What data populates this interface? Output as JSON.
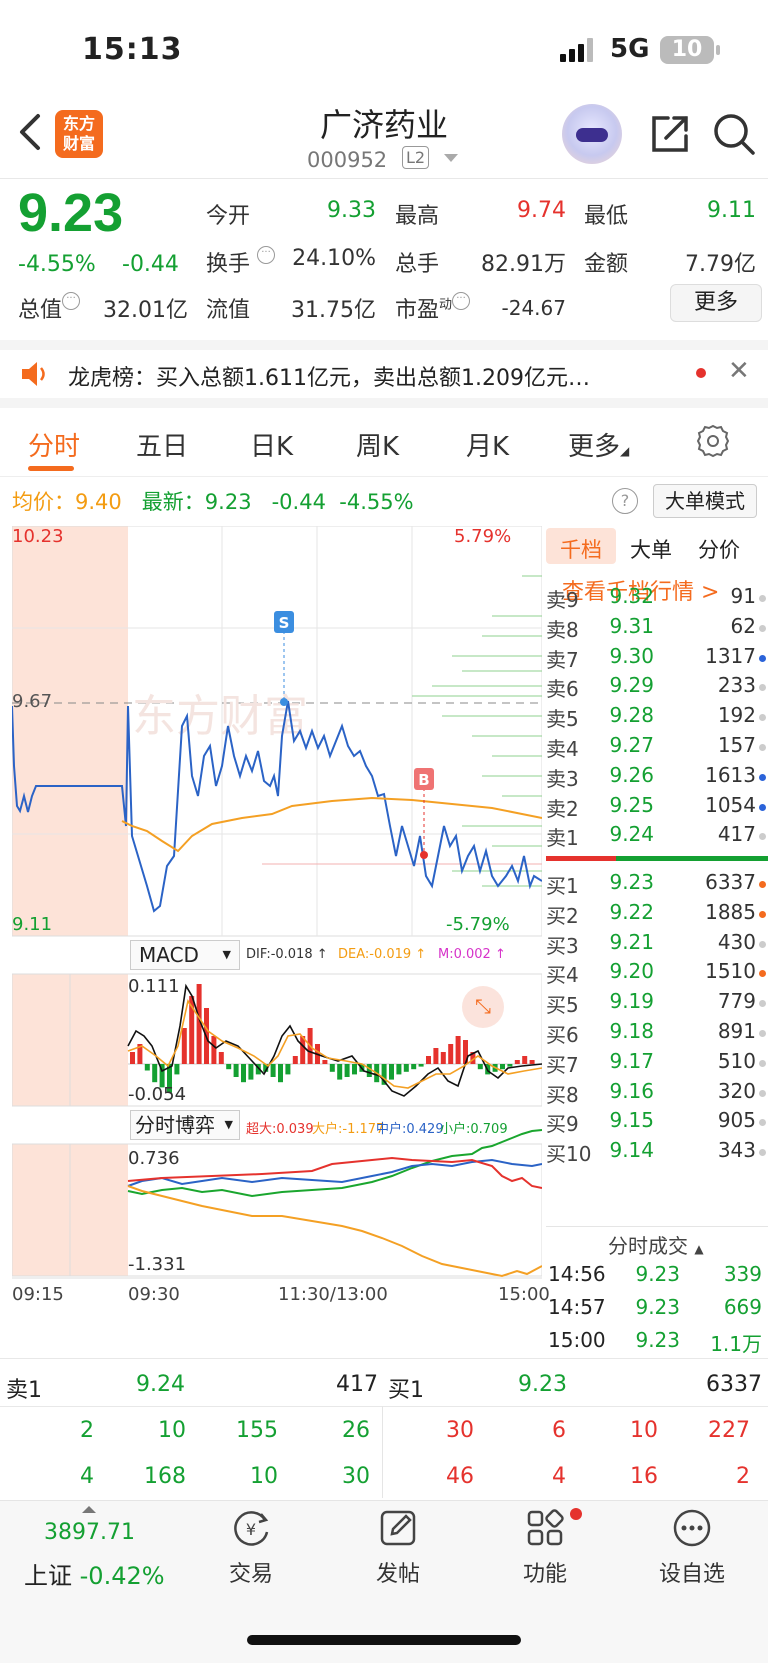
{
  "status_bar": {
    "time": "15:13",
    "network": "5G",
    "battery": "10"
  },
  "header": {
    "logo": "东方\n财富",
    "title": "广济药业",
    "code": "000952",
    "level_badge": "L2"
  },
  "quote": {
    "price": "9.23",
    "change_pct": "-4.55%",
    "change": "-0.44",
    "open_label": "今开",
    "open": "9.33",
    "high_label": "最高",
    "high": "9.74",
    "low_label": "最低",
    "low": "9.11",
    "turnover_rate_label": "换手",
    "turnover_rate": "24.10%",
    "volume_label": "总手",
    "volume": "82.91万",
    "amount_label": "金额",
    "amount": "7.79亿",
    "market_cap_label": "总值",
    "market_cap": "32.01亿",
    "float_cap_label": "流值",
    "float_cap": "31.75亿",
    "pe_label": "市盈",
    "pe_sup": "动",
    "pe": "-24.67",
    "more_label": "更多"
  },
  "ticker": {
    "text": "龙虎榜：买入总额1.611亿元，卖出总额1.209亿元…"
  },
  "tabs": [
    {
      "label": "分时"
    },
    {
      "label": "五日"
    },
    {
      "label": "日K"
    },
    {
      "label": "周K"
    },
    {
      "label": "月K"
    },
    {
      "label": "更多"
    }
  ],
  "info": {
    "avg_label": "均价：",
    "avg": "9.40",
    "latest_label": "最新：",
    "latest": "9.23",
    "latest_chg": "-0.44",
    "latest_pct": "-4.55%",
    "big_order_label": "大单模式"
  },
  "chart": {
    "y_top": "10.23",
    "y_top_pct": "5.79%",
    "ref_price": "9.67",
    "y_bottom": "9.11",
    "y_bottom_pct": "-5.79%",
    "watermark": "东方财富",
    "marker_s": "S",
    "marker_b": "B",
    "macd_label": "MACD",
    "dif": "DIF:-0.018 ↑",
    "dea": "DEA:-0.019 ↑",
    "m": "M:0.002 ↑",
    "macd_top": "0.111",
    "macd_bottom": "-0.054",
    "game_label": "分时博弈",
    "super_large": "超大:0.039",
    "large": "大户:-1.177",
    "medium": "中户:0.429",
    "small": "小户:0.709",
    "game_top": "0.736",
    "game_bottom": "-1.331",
    "time_labels": [
      "09:15",
      "09:30",
      "11:30/13:00",
      "15:00"
    ]
  },
  "order_book": {
    "tabs": [
      "千档",
      "大单",
      "分价"
    ],
    "link": "查看千档行情 >",
    "asks": [
      {
        "label": "卖9",
        "price": "9.32",
        "vol": "91",
        "dot": "#cccccc"
      },
      {
        "label": "卖8",
        "price": "9.31",
        "vol": "62",
        "dot": "#cccccc"
      },
      {
        "label": "卖7",
        "price": "9.30",
        "vol": "1317",
        "dot": "#2b63d9"
      },
      {
        "label": "卖6",
        "price": "9.29",
        "vol": "233",
        "dot": "#cccccc"
      },
      {
        "label": "卖5",
        "price": "9.28",
        "vol": "192",
        "dot": "#cccccc"
      },
      {
        "label": "卖4",
        "price": "9.27",
        "vol": "157",
        "dot": "#cccccc"
      },
      {
        "label": "卖3",
        "price": "9.26",
        "vol": "1613",
        "dot": "#2b63d9"
      },
      {
        "label": "卖2",
        "price": "9.25",
        "vol": "1054",
        "dot": "#2b63d9"
      },
      {
        "label": "卖1",
        "price": "9.24",
        "vol": "417",
        "dot": "#cccccc"
      }
    ],
    "bids": [
      {
        "label": "买1",
        "price": "9.23",
        "vol": "6337",
        "dot": "#f46b1e"
      },
      {
        "label": "买2",
        "price": "9.22",
        "vol": "1885",
        "dot": "#f46b1e"
      },
      {
        "label": "买3",
        "price": "9.21",
        "vol": "430",
        "dot": "#cccccc"
      },
      {
        "label": "买4",
        "price": "9.20",
        "vol": "1510",
        "dot": "#f46b1e"
      },
      {
        "label": "买5",
        "price": "9.19",
        "vol": "779",
        "dot": "#cccccc"
      },
      {
        "label": "买6",
        "price": "9.18",
        "vol": "891",
        "dot": "#cccccc"
      },
      {
        "label": "买7",
        "price": "9.17",
        "vol": "510",
        "dot": "#cccccc"
      },
      {
        "label": "买8",
        "price": "9.16",
        "vol": "320",
        "dot": "#cccccc"
      },
      {
        "label": "买9",
        "price": "9.15",
        "vol": "905",
        "dot": "#cccccc"
      },
      {
        "label": "买10",
        "price": "9.14",
        "vol": "343",
        "dot": "#cccccc"
      }
    ],
    "trades_title": "分时成交",
    "trades": [
      {
        "time": "14:56",
        "price": "9.23",
        "vol": "339"
      },
      {
        "time": "14:57",
        "price": "9.23",
        "vol": "669"
      },
      {
        "time": "15:00",
        "price": "9.23",
        "vol": "1.1万"
      }
    ]
  },
  "level1": {
    "sell_label": "卖1",
    "sell_price": "9.24",
    "sell_vol": "417",
    "buy_label": "买1",
    "buy_price": "9.23",
    "buy_vol": "6337",
    "sell_orders_row1": [
      "2",
      "10",
      "155",
      "26"
    ],
    "sell_orders_row2": [
      "4",
      "168",
      "10",
      "30"
    ],
    "buy_orders_row1": [
      "30",
      "6",
      "10",
      "227"
    ],
    "buy_orders_row2": [
      "46",
      "4",
      "16",
      "2"
    ]
  },
  "bottom_nav": {
    "index_value": "3897.71",
    "index_name": "上证",
    "index_pct": "-0.42%",
    "items": [
      {
        "label": "交易"
      },
      {
        "label": "发帖"
      },
      {
        "label": "功能"
      },
      {
        "label": "设自选"
      }
    ]
  }
}
